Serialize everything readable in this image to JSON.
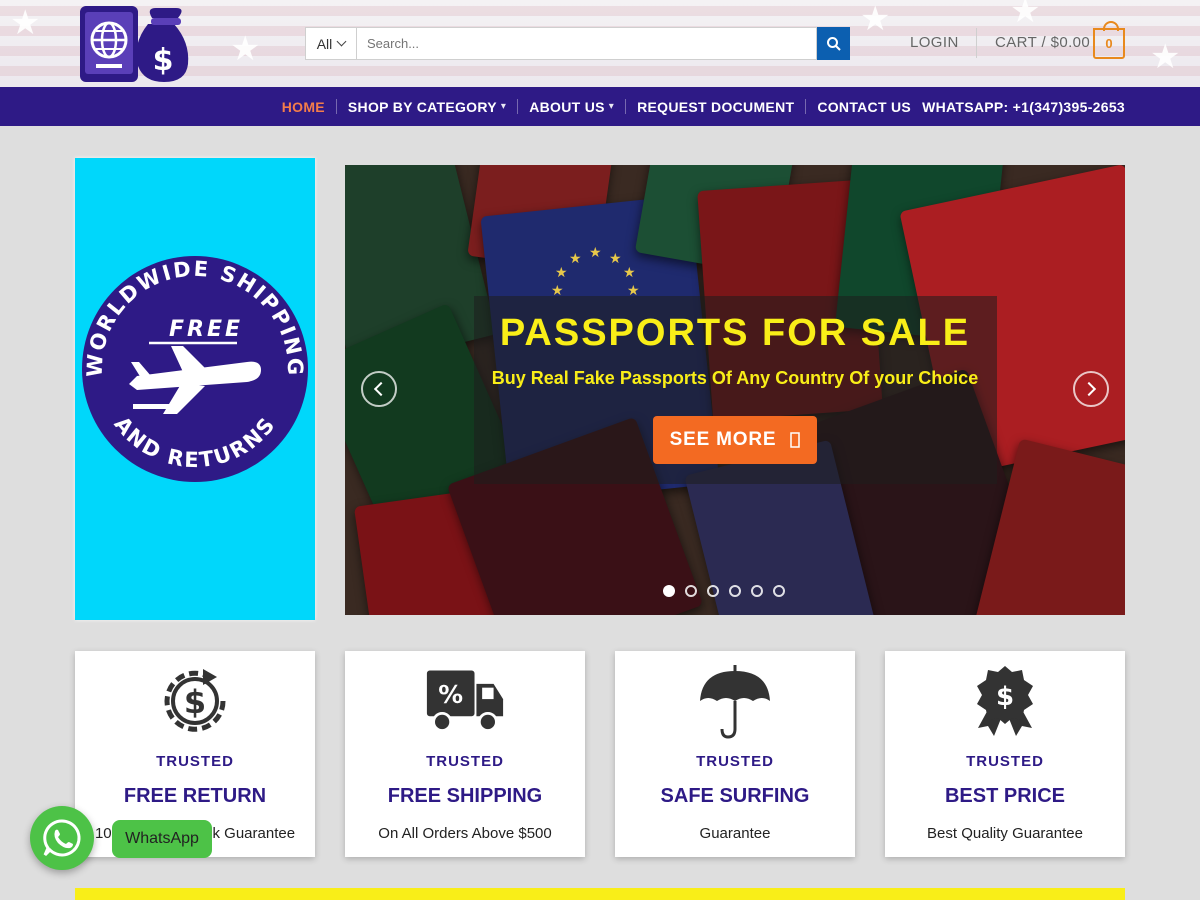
{
  "header": {
    "search": {
      "category": "All",
      "placeholder": "Search..."
    },
    "login_label": "LOGIN",
    "cart_label": "CART / $0.00",
    "cart_count": "0"
  },
  "nav": {
    "items": [
      {
        "label": "HOME"
      },
      {
        "label": "SHOP BY CATEGORY"
      },
      {
        "label": "ABOUT US"
      },
      {
        "label": "REQUEST DOCUMENT"
      },
      {
        "label": "CONTACT US"
      }
    ],
    "phone": "WHATSAPP: +1(347)395-2653"
  },
  "side_banner": {
    "ring_text_top": "WORLDWIDE SHIPPING",
    "ring_text_bottom": "AND RETURNS",
    "badge": "FREE"
  },
  "slider": {
    "title": "PASSPORTS FOR SALE",
    "subtitle": "Buy Real Fake Passports Of Any Country Of your Choice",
    "button_label": "SEE MORE",
    "dots": 6,
    "active_dot": 0
  },
  "features": [
    {
      "icon": "money-return-icon",
      "supertitle": "TRUSTED",
      "title": "FREE RETURN",
      "desc": "100% Money Back Guarantee"
    },
    {
      "icon": "delivery-truck-icon",
      "supertitle": "TRUSTED",
      "title": "FREE SHIPPING",
      "desc": "On All Orders Above $500"
    },
    {
      "icon": "umbrella-icon",
      "supertitle": "TRUSTED",
      "title": "SAFE SURFING",
      "desc": "Guarantee"
    },
    {
      "icon": "award-badge-icon",
      "supertitle": "TRUSTED",
      "title": "BEST PRICE",
      "desc": "Best Quality Guarantee"
    }
  ],
  "whatsapp": {
    "label": "WhatsApp"
  },
  "colors": {
    "nav_bg": "#2e1a86",
    "accent_orange": "#f36a22",
    "title_yellow": "#f9ee18",
    "side_banner_bg": "#00d7fb",
    "whatsapp_green": "#4dc247"
  }
}
